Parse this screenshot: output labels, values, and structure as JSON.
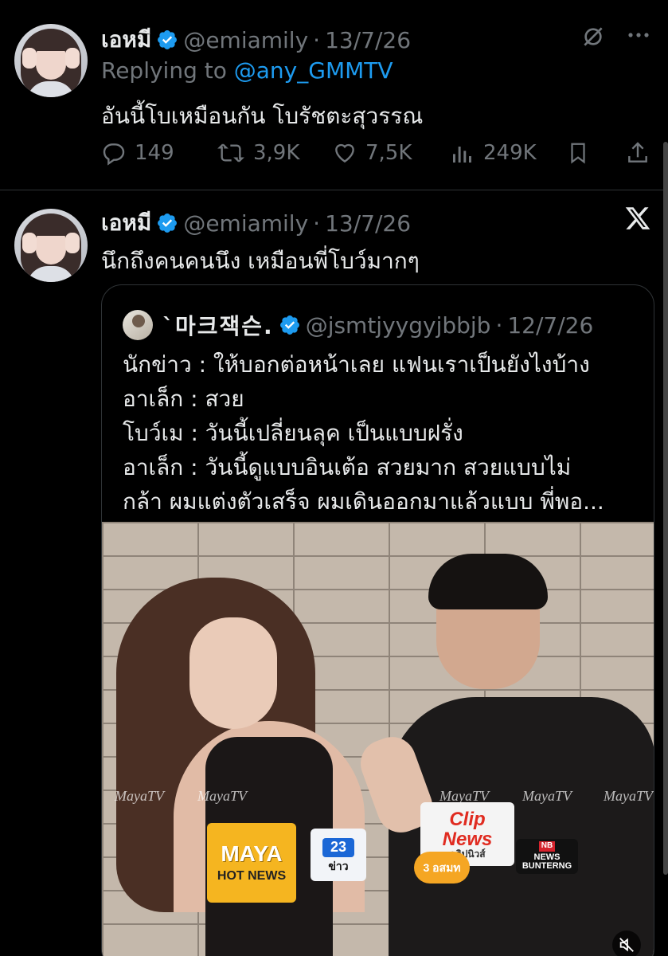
{
  "tweet1": {
    "name": "เอหมี",
    "handle": "@emiamily",
    "separator": "·",
    "date": "13/7/26",
    "replying_prefix": "Replying to ",
    "replying_to": "@any_GMMTV",
    "text": "อันนี้โบเหมือนกัน โบรัชตะสุวรรณ",
    "stats": {
      "replies": "149",
      "reposts": "3,9K",
      "likes": "7,5K",
      "views": "249K"
    }
  },
  "tweet2": {
    "name": "เอหมี",
    "handle": "@emiamily",
    "separator": "·",
    "date": "13/7/26",
    "text": "นึกถึงคนคนนึง เหมือนพี่โบว์มากๆ"
  },
  "quote": {
    "name": "`마크잭슨.",
    "handle": "@jsmtjyygyjbbjb",
    "separator": "·",
    "date": "12/7/26",
    "lines": [
      "นักข่าว : ให้บอกต่อหน้าเลย แฟนเราเป็นยังไงบ้าง",
      "อาเล็ก : สวย",
      "โบว์เม : วันนี้เปลี่ยนลุค เป็นแบบฝรั่ง",
      "อาเล็ก : วันนี้ดูแบบอินเต้อ สวยมาก สวยแบบไม่",
      "กล้า ผมแต่งตัวเสร็จ ผมเดินออกมาแล้วแบบ พี่พอ..."
    ],
    "media": {
      "watermark": "MayaTV",
      "mic_maya_top": "MAYA",
      "mic_maya_bottom": "HOT NEWS",
      "mic_23_num": "23",
      "mic_23_label": "ข่าว",
      "mic_clip_top": "Clip",
      "mic_clip_mid": "News",
      "mic_clip_sub": "คลิปนิวส์",
      "mic_ch3": "3 อสมท",
      "mic_nb_tag": "NB",
      "mic_nb_text": "NEWS BUNTERNG"
    }
  },
  "colors": {
    "background": "#000000",
    "text": "#e7e9ea",
    "muted": "#71767b",
    "link": "#1d9bf0",
    "verified": "#1d9bf0",
    "border": "#2f3336"
  }
}
